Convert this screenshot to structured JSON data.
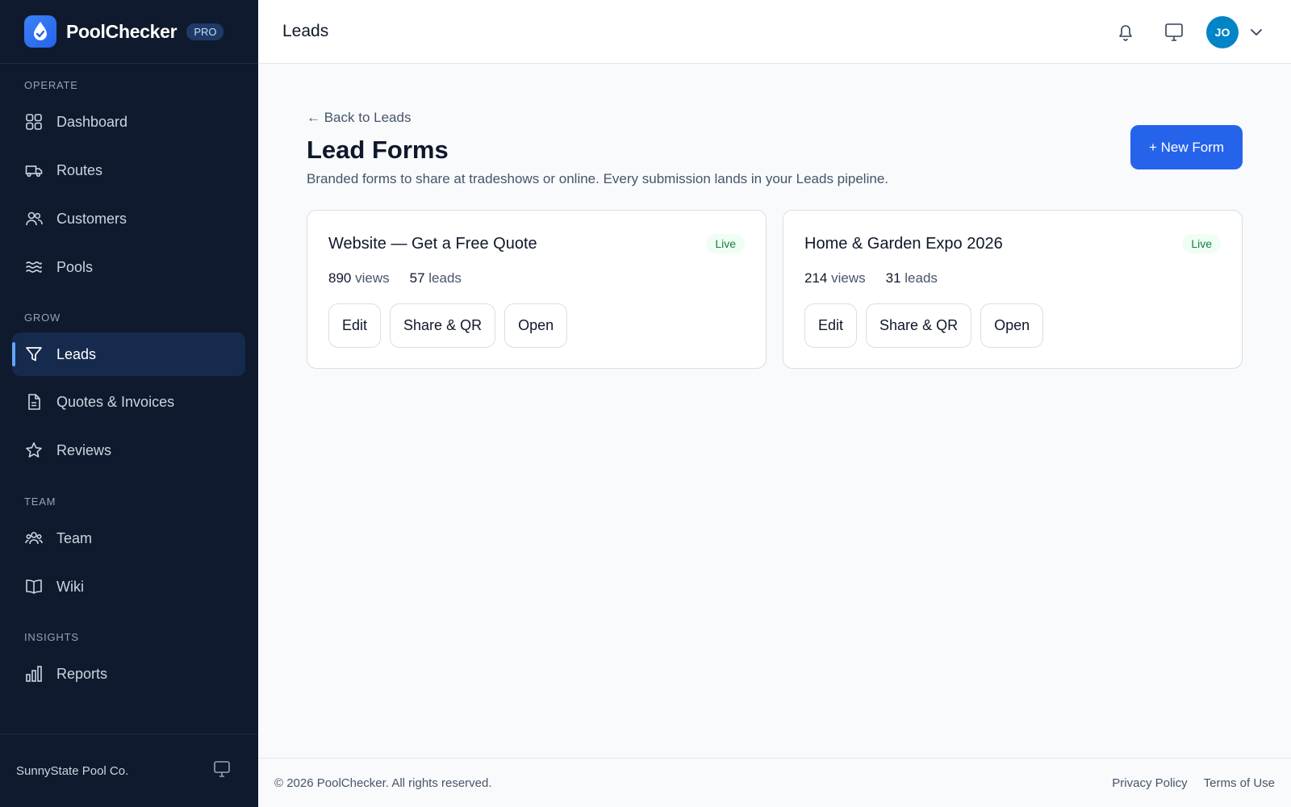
{
  "app": {
    "name": "PoolChecker",
    "badge": "PRO"
  },
  "sidebar": {
    "sections": [
      {
        "label": "OPERATE"
      },
      {
        "label": "GROW"
      },
      {
        "label": "TEAM"
      },
      {
        "label": "INSIGHTS"
      }
    ],
    "items": [
      {
        "label": "Dashboard",
        "icon": "grid-icon"
      },
      {
        "label": "Routes",
        "icon": "truck-icon"
      },
      {
        "label": "Customers",
        "icon": "users-icon"
      },
      {
        "label": "Pools",
        "icon": "waves-icon"
      },
      {
        "label": "Leads",
        "icon": "funnel-icon",
        "active": true
      },
      {
        "label": "Quotes & Invoices",
        "icon": "document-icon"
      },
      {
        "label": "Reviews",
        "icon": "star-icon"
      },
      {
        "label": "Team",
        "icon": "team-icon"
      },
      {
        "label": "Wiki",
        "icon": "book-icon"
      },
      {
        "label": "Reports",
        "icon": "bar-chart-icon"
      }
    ],
    "company": "SunnyState Pool Co."
  },
  "header": {
    "title": "Leads",
    "avatar_initials": "JO"
  },
  "main": {
    "back_link": "← Back to Leads",
    "title": "Lead Forms",
    "description": "Branded forms to share at tradeshows or online. Every submission lands in your Leads pipeline.",
    "new_form_label": "+ New Form",
    "forms": [
      {
        "title": "Website — Get a Free Quote",
        "status": "Live",
        "views": "890",
        "views_label": "views",
        "leads": "57",
        "leads_label": "leads",
        "actions": [
          "Edit",
          "Share & QR",
          "Open"
        ]
      },
      {
        "title": "Home & Garden Expo 2026",
        "status": "Live",
        "views": "214",
        "views_label": "views",
        "leads": "31",
        "leads_label": "leads",
        "actions": [
          "Edit",
          "Share & QR",
          "Open"
        ]
      }
    ]
  },
  "footer": {
    "copyright": "© 2026 PoolChecker. All rights reserved.",
    "links": [
      "Privacy Policy",
      "Terms of Use"
    ]
  },
  "colors": {
    "sidebar_bg": "#0f1a2e",
    "accent": "#2563eb",
    "live": "#15803d",
    "avatar": "#0284c7"
  }
}
